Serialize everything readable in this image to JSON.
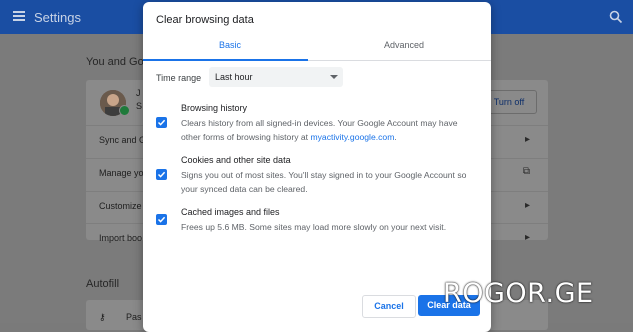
{
  "app": {
    "title": "Settings"
  },
  "background": {
    "you_and_google": "You and Goo",
    "profile_name": "J",
    "profile_sub": "S",
    "turn_off": "Turn off",
    "rows": [
      "Sync and G",
      "Manage yo",
      "Customize",
      "Import boo"
    ],
    "autofill": "Autofill",
    "passwords": "Pas"
  },
  "dialog": {
    "title": "Clear browsing data",
    "tabs": {
      "basic": "Basic",
      "advanced": "Advanced"
    },
    "time_range": {
      "label": "Time range",
      "value": "Last hour"
    },
    "options": [
      {
        "title": "Browsing history",
        "desc": "Clears history from all signed-in devices. Your Google Account may have other forms of browsing history at",
        "link": "myactivity.google.com",
        "desc_end": ".",
        "checked": true
      },
      {
        "title": "Cookies and other site data",
        "desc": "Signs you out of most sites. You'll stay signed in to your Google Account so your synced data can be cleared.",
        "checked": true
      },
      {
        "title": "Cached images and files",
        "desc": "Frees up 5.6 MB. Some sites may load more slowly on your next visit.",
        "checked": true
      }
    ],
    "cancel": "Cancel",
    "clear": "Clear data"
  },
  "watermark": "ROGOR.GE",
  "colors": {
    "accent": "#1a73e8",
    "topbar": "#1a4ea3"
  }
}
